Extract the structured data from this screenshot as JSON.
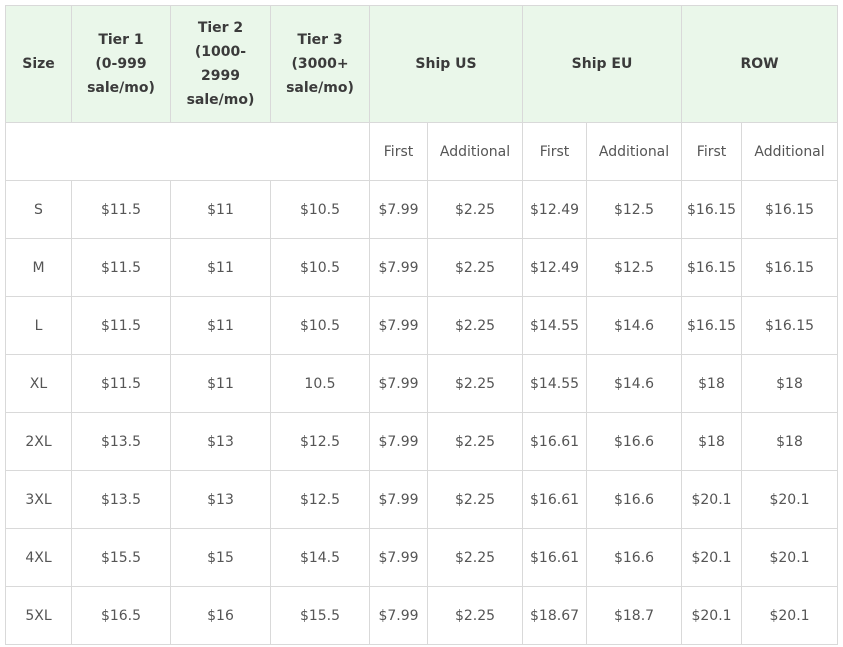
{
  "columns": {
    "size": "Size",
    "tier1": [
      "Tier 1",
      "(0-999",
      "sale/mo)"
    ],
    "tier2": [
      "Tier 2",
      "(1000-",
      "2999",
      "sale/mo)"
    ],
    "tier3": [
      "Tier 3",
      "(3000+",
      "sale/mo)"
    ],
    "ship_us": "Ship US",
    "ship_eu": "Ship EU",
    "row": "ROW"
  },
  "sub_headers": {
    "us_first": "First",
    "us_additional": "Additional",
    "eu_first": "First",
    "eu_additional": "Additional",
    "row_first": "First",
    "row_additional": "Additional"
  },
  "rows": [
    [
      "S",
      "$11.5",
      "$11",
      "$10.5",
      "$7.99",
      "$2.25",
      "$12.49",
      "$12.5",
      "$16.15",
      "$16.15"
    ],
    [
      "M",
      "$11.5",
      "$11",
      "$10.5",
      "$7.99",
      "$2.25",
      "$12.49",
      "$12.5",
      "$16.15",
      "$16.15"
    ],
    [
      "L",
      "$11.5",
      "$11",
      "$10.5",
      "$7.99",
      "$2.25",
      "$14.55",
      "$14.6",
      "$16.15",
      "$16.15"
    ],
    [
      "XL",
      "$11.5",
      "$11",
      "10.5",
      "$7.99",
      "$2.25",
      "$14.55",
      "$14.6",
      "$18",
      "$18"
    ],
    [
      "2XL",
      "$13.5",
      "$13",
      "$12.5",
      "$7.99",
      "$2.25",
      "$16.61",
      "$16.6",
      "$18",
      "$18"
    ],
    [
      "3XL",
      "$13.5",
      "$13",
      "$12.5",
      "$7.99",
      "$2.25",
      "$16.61",
      "$16.6",
      "$20.1",
      "$20.1"
    ],
    [
      "4XL",
      "$15.5",
      "$15",
      "$14.5",
      "$7.99",
      "$2.25",
      "$16.61",
      "$16.6",
      "$20.1",
      "$20.1"
    ],
    [
      "5XL",
      "$16.5",
      "$16",
      "$15.5",
      "$7.99",
      "$2.25",
      "$18.67",
      "$18.7",
      "$20.1",
      "$20.1"
    ]
  ],
  "colors": {
    "header_bg": "#eaf7ea",
    "border": "#d9d9d9",
    "text": "#555555"
  }
}
